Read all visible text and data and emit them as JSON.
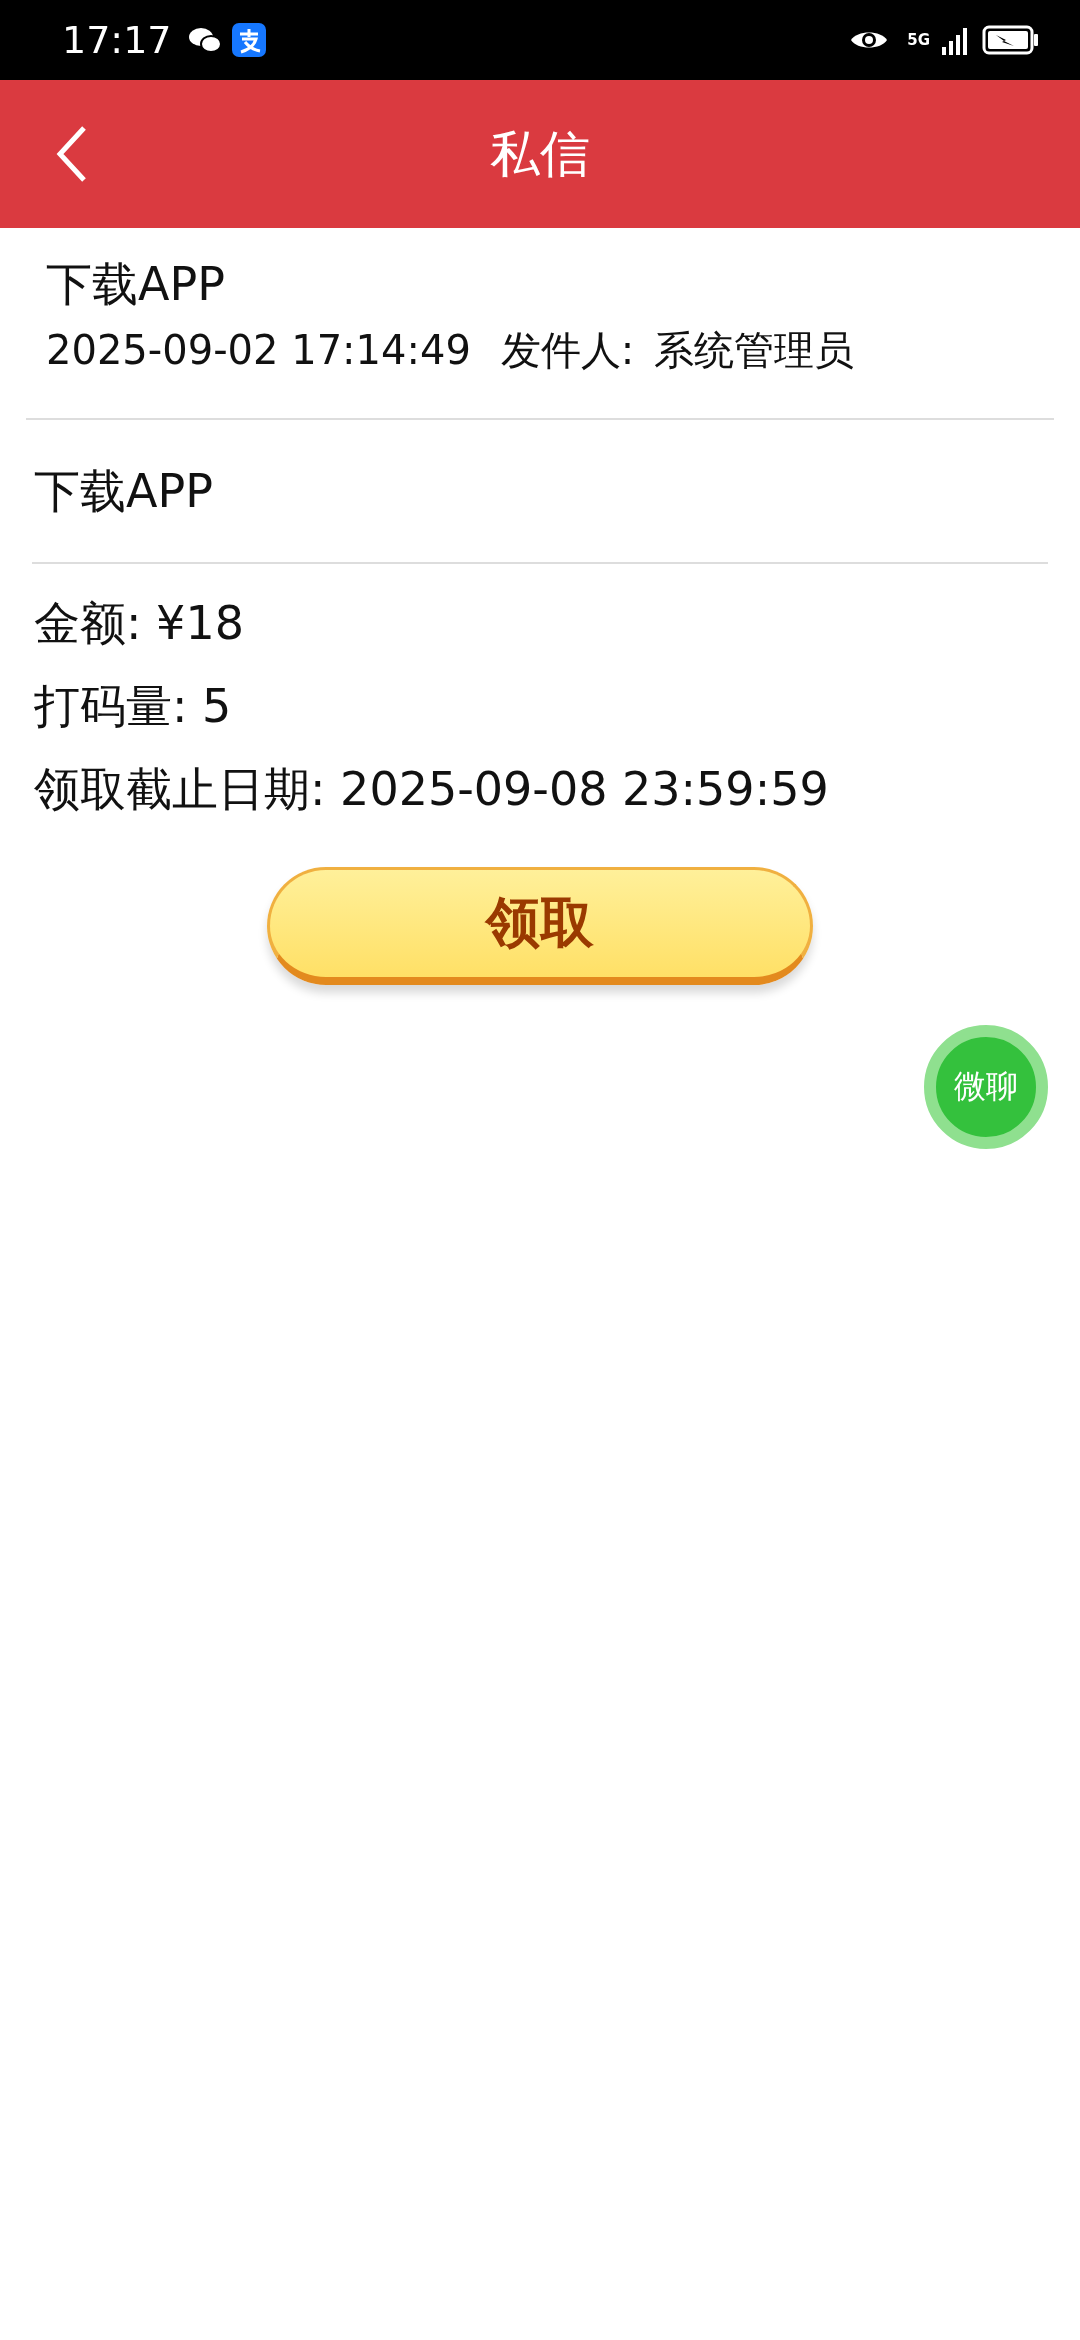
{
  "status_bar": {
    "time": "17:17",
    "network": "5G"
  },
  "header": {
    "title": "私信"
  },
  "message": {
    "subject": "下载APP",
    "timestamp": "2025-09-02 17:14:49",
    "sender_label": "发件人:",
    "sender": "系统管理员",
    "body_title": "下载APP",
    "details": [
      "金额: ¥18",
      "打码量: 5",
      "领取截止日期: 2025-09-08 23:59:59"
    ]
  },
  "claim_button": "领取",
  "chat_button": "微聊"
}
